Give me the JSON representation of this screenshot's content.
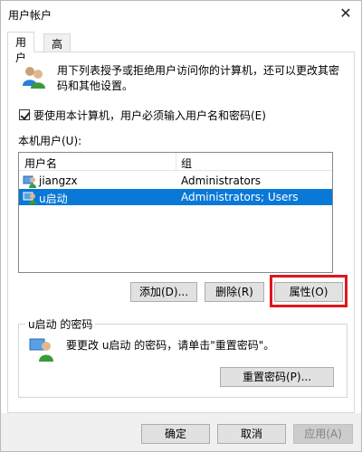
{
  "window": {
    "title": "用户帐户",
    "close_glyph": "✕"
  },
  "tabs": [
    {
      "label": "用户",
      "active": true
    },
    {
      "label": "高级",
      "active": false
    }
  ],
  "intro": {
    "text": "用下列表授予或拒绝用户访问你的计算机，还可以更改其密码和其他设置。"
  },
  "require_login": {
    "checked": true,
    "label": "要使用本计算机，用户必须输入用户名和密码(E)"
  },
  "local_users": {
    "label": "本机用户(U):",
    "columns": [
      "用户名",
      "组"
    ],
    "rows": [
      {
        "name": "jiangzx",
        "group": "Administrators",
        "selected": false
      },
      {
        "name": "u启动",
        "group": "Administrators; Users",
        "selected": true
      }
    ],
    "buttons": {
      "add": "添加(D)...",
      "remove": "删除(R)",
      "properties": "属性(O)"
    }
  },
  "password_group": {
    "title": "u启动 的密码",
    "text": "要更改 u启动 的密码，请单击\"重置密码\"。",
    "reset_button": "重置密码(P)..."
  },
  "footer": {
    "ok": "确定",
    "cancel": "取消",
    "apply": "应用(A)"
  },
  "colors": {
    "selection": "#0a78d7",
    "highlight_box": "#e0161c",
    "dialog_bg": "#f0f0f0"
  },
  "icons": {
    "users": "users-icon",
    "user": "user-icon",
    "password": "user-key-icon",
    "close": "close-icon"
  }
}
